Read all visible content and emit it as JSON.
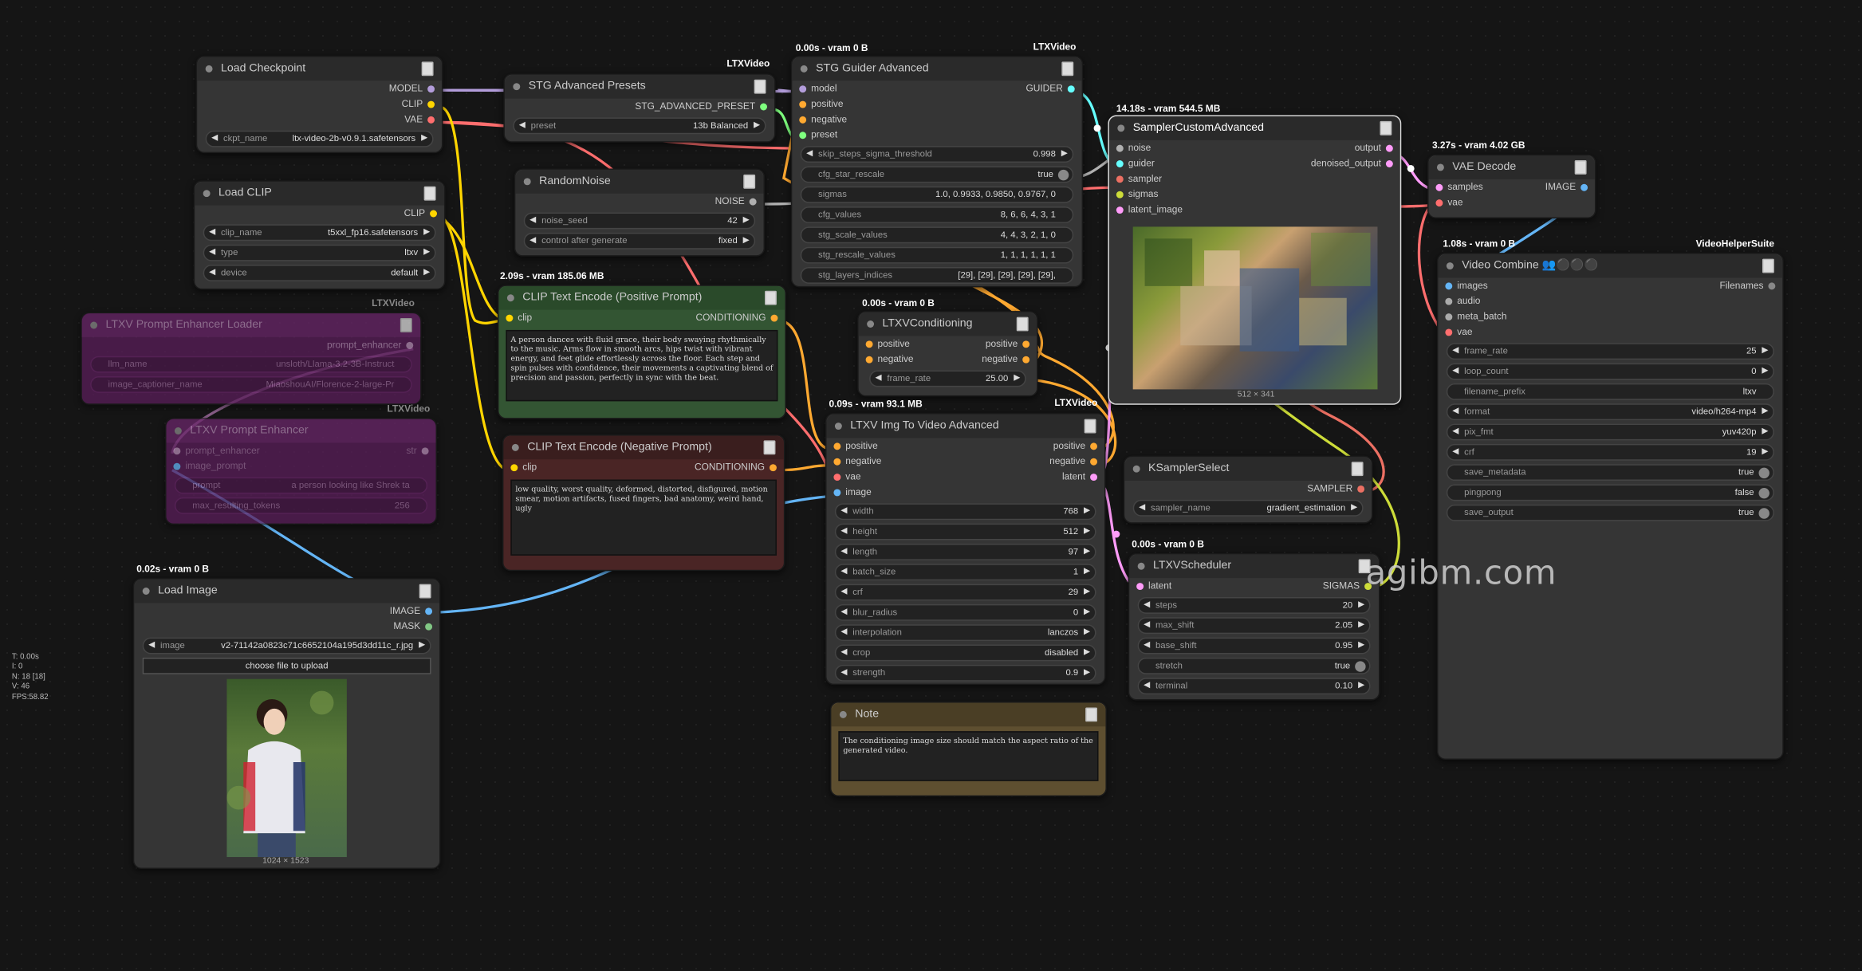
{
  "colors": {
    "model": "#b39ddb",
    "clip": "#ffd500",
    "vae": "#ff6e6e",
    "noise": "#b0b0b0",
    "guider": "#66ffff",
    "sampler": "#ec7063",
    "sigmas": "#cddc39",
    "latent": "#ff9cf9",
    "image": "#64b5f6",
    "conditioning": "#ffa931",
    "mask": "#81c784",
    "preset": "#7fff7f"
  },
  "stats": {
    "t": "T: 0.00s",
    "i": "I: 0",
    "n": "N: 18 [18]",
    "v": "V: 46",
    "fps": "FPS:58.82"
  },
  "watermark": "agibm.com",
  "load_checkpoint": {
    "title": "Load Checkpoint",
    "out_model": "MODEL",
    "out_clip": "CLIP",
    "out_vae": "VAE",
    "ckpt_label": "ckpt_name",
    "ckpt_value": "ltx-video-2b-v0.9.1.safetensors"
  },
  "load_clip": {
    "title": "Load CLIP",
    "out_clip": "CLIP",
    "clip_name_label": "clip_name",
    "clip_name_value": "t5xxl_fp16.safetensors",
    "type_label": "type",
    "type_value": "ltxv",
    "device_label": "device",
    "device_value": "default"
  },
  "stg_presets": {
    "badge": "LTXVideo",
    "title": "STG Advanced Presets",
    "out": "STG_ADVANCED_PRESET",
    "preset_label": "preset",
    "preset_value": "13b Balanced"
  },
  "random_noise": {
    "title": "RandomNoise",
    "out": "NOISE",
    "seed_label": "noise_seed",
    "seed_value": "42",
    "cag_label": "control after generate",
    "cag_value": "fixed"
  },
  "stg_guider": {
    "badge_left": "0.00s - vram 0 B",
    "badge_right": "LTXVideo",
    "title": "STG Guider Advanced",
    "in_model": "model",
    "in_positive": "positive",
    "in_negative": "negative",
    "in_preset": "preset",
    "out": "GUIDER",
    "widgets": [
      {
        "l": "skip_steps_sigma_threshold",
        "v": "0.998",
        "k": "num"
      },
      {
        "l": "cfg_star_rescale",
        "v": "true",
        "k": "toggle"
      },
      {
        "l": "sigmas",
        "v": "1.0, 0.9933, 0.9850, 0.9767, 0",
        "k": "text"
      },
      {
        "l": "cfg_values",
        "v": "8, 6, 6, 4, 3, 1",
        "k": "text"
      },
      {
        "l": "stg_scale_values",
        "v": "4, 4, 3, 2, 1, 0",
        "k": "text"
      },
      {
        "l": "stg_rescale_values",
        "v": "1, 1, 1, 1, 1, 1",
        "k": "text"
      },
      {
        "l": "stg_layers_indices",
        "v": "[29], [29], [29], [29], [29],",
        "k": "text"
      }
    ]
  },
  "sampler_custom": {
    "badge": "14.18s - vram 544.5 MB",
    "title": "SamplerCustomAdvanced",
    "in_noise": "noise",
    "in_guider": "guider",
    "in_sampler": "sampler",
    "in_sigmas": "sigmas",
    "in_latent": "latent_image",
    "out_output": "output",
    "out_denoised": "denoised_output",
    "dim": "512 × 341"
  },
  "vae_decode": {
    "badge": "3.27s - vram 4.02 GB",
    "title": "VAE Decode",
    "in_samples": "samples",
    "in_vae": "vae",
    "out": "IMAGE"
  },
  "video_combine": {
    "badge_left": "1.08s - vram 0 B",
    "badge_right": "VideoHelperSuite",
    "title": "Video Combine 👥⚫⚫⚫",
    "in_images": "images",
    "in_audio": "audio",
    "in_meta": "meta_batch",
    "in_vae": "vae",
    "out": "Filenames",
    "widgets": [
      {
        "l": "frame_rate",
        "v": "25",
        "k": "num"
      },
      {
        "l": "loop_count",
        "v": "0",
        "k": "num"
      },
      {
        "l": "filename_prefix",
        "v": "ltxv",
        "k": "text"
      },
      {
        "l": "format",
        "v": "video/h264-mp4",
        "k": "num"
      },
      {
        "l": "pix_fmt",
        "v": "yuv420p",
        "k": "num"
      },
      {
        "l": "crf",
        "v": "19",
        "k": "num"
      },
      {
        "l": "save_metadata",
        "v": "true",
        "k": "toggle"
      },
      {
        "l": "pingpong",
        "v": "false",
        "k": "toggle"
      },
      {
        "l": "save_output",
        "v": "true",
        "k": "toggle"
      }
    ]
  },
  "prompt_loader": {
    "badge": "LTXVideo",
    "title": "LTXV Prompt Enhancer Loader",
    "out": "prompt_enhancer",
    "llm_label": "llm_name",
    "llm_value": "unsloth/Llama-3.2-3B-Instruct",
    "cap_label": "image_captioner_name",
    "cap_value": "MiaoshouAI/Florence-2-large-Pr"
  },
  "prompt_enhancer": {
    "badge": "LTXVideo",
    "title": "LTXV Prompt Enhancer",
    "in_enh": "prompt_enhancer",
    "in_img": "image_prompt",
    "out": "str",
    "prompt_label": "prompt",
    "prompt_value": "a person looking like Shrek ta",
    "max_label": "max_resulting_tokens",
    "max_value": "256"
  },
  "clip_pos": {
    "badge": "2.09s - vram 185.06 MB",
    "title": "CLIP Text Encode (Positive Prompt)",
    "in": "clip",
    "out": "CONDITIONING",
    "text": "A person dances with fluid grace, their body swaying rhythmically to the music. Arms flow in smooth arcs, hips twist with vibrant energy, and feet glide effortlessly across the floor. Each step and spin pulses with confidence, their movements a captivating blend of precision and passion, perfectly in sync with the beat."
  },
  "clip_neg": {
    "title": "CLIP Text Encode (Negative Prompt)",
    "in": "clip",
    "out": "CONDITIONING",
    "text": "low quality, worst quality, deformed, distorted, disfigured, motion smear, motion artifacts, fused fingers, bad anatomy, weird hand, ugly"
  },
  "ltxv_cond": {
    "badge": "0.00s - vram 0 B",
    "title": "LTXVConditioning",
    "in_pos": "positive",
    "in_neg": "negative",
    "out_pos": "positive",
    "out_neg": "negative",
    "fr_label": "frame_rate",
    "fr_value": "25.00"
  },
  "img2vid": {
    "badge_left": "0.09s - vram 93.1 MB",
    "badge_right": "LTXVideo",
    "title": "LTXV Img To Video Advanced",
    "in_pos": "positive",
    "in_neg": "negative",
    "in_vae": "vae",
    "in_image": "image",
    "out_pos": "positive",
    "out_neg": "negative",
    "out_latent": "latent",
    "widgets": [
      {
        "l": "width",
        "v": "768",
        "k": "num"
      },
      {
        "l": "height",
        "v": "512",
        "k": "num"
      },
      {
        "l": "length",
        "v": "97",
        "k": "num"
      },
      {
        "l": "batch_size",
        "v": "1",
        "k": "num"
      },
      {
        "l": "crf",
        "v": "29",
        "k": "num"
      },
      {
        "l": "blur_radius",
        "v": "0",
        "k": "num"
      },
      {
        "l": "interpolation",
        "v": "lanczos",
        "k": "num"
      },
      {
        "l": "crop",
        "v": "disabled",
        "k": "num"
      },
      {
        "l": "strength",
        "v": "0.9",
        "k": "num"
      }
    ]
  },
  "ksampler_select": {
    "title": "KSamplerSelect",
    "out": "SAMPLER",
    "label": "sampler_name",
    "value": "gradient_estimation"
  },
  "scheduler": {
    "badge": "0.00s - vram 0 B",
    "title": "LTXVScheduler",
    "in": "latent",
    "out": "SIGMAS",
    "widgets": [
      {
        "l": "steps",
        "v": "20",
        "k": "num"
      },
      {
        "l": "max_shift",
        "v": "2.05",
        "k": "num"
      },
      {
        "l": "base_shift",
        "v": "0.95",
        "k": "num"
      },
      {
        "l": "stretch",
        "v": "true",
        "k": "toggle"
      },
      {
        "l": "terminal",
        "v": "0.10",
        "k": "num"
      }
    ]
  },
  "note": {
    "title": "Note",
    "text": "The conditioning image size should match the aspect ratio of the generated video."
  },
  "load_image": {
    "badge": "0.02s - vram 0 B",
    "title": "Load Image",
    "out_image": "IMAGE",
    "out_mask": "MASK",
    "image_label": "image",
    "image_value": "v2-71142a0823c71c6652104a195d3dd11c_r.jpg",
    "upload": "choose file to upload",
    "dim": "1024 × 1523"
  }
}
